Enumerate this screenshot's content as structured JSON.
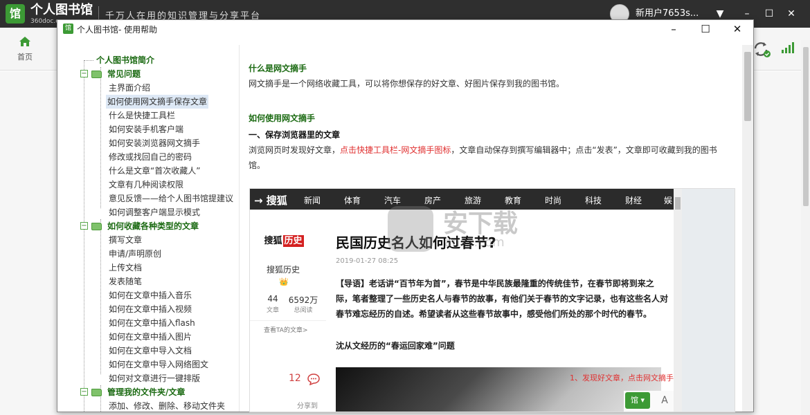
{
  "app": {
    "name": "个人图书馆",
    "domain": "360doc.c",
    "slogan": "千万人在用的知识管理与分享平台",
    "user_name": "新用户7653s...",
    "home_label": "首页",
    "logo_char": "馆"
  },
  "dialog": {
    "title": "个人图书馆- 使用帮助",
    "logo_char": "馆"
  },
  "nav": {
    "items": [
      {
        "label": "个人图书馆简介"
      },
      {
        "label": "常见问题"
      },
      {
        "label": "主界面介绍"
      },
      {
        "label": "如何使用网文摘手保存文章"
      },
      {
        "label": "什么是快捷工具栏"
      },
      {
        "label": "如何安装手机客户端"
      },
      {
        "label": "如何安装浏览器网文摘手"
      },
      {
        "label": "修改或找回自己的密码"
      },
      {
        "label": "什么是文章“首次收藏人”"
      },
      {
        "label": "文章有几种阅读权限"
      },
      {
        "label": "意见反馈——给个人图书馆提建议"
      },
      {
        "label": "如何调整客户端显示模式"
      },
      {
        "label": "如何收藏各种类型的文章"
      },
      {
        "label": "撰写文章"
      },
      {
        "label": "申请/声明原创"
      },
      {
        "label": "上传文档"
      },
      {
        "label": "发表随笔"
      },
      {
        "label": "如何在文章中插入音乐"
      },
      {
        "label": "如何在文章中插入视频"
      },
      {
        "label": "如何在文章中插入flash"
      },
      {
        "label": "如何在文章中插入图片"
      },
      {
        "label": "如何在文章中导入文档"
      },
      {
        "label": "如何在文章中导入网络图文"
      },
      {
        "label": "如何对文章进行一键排版"
      },
      {
        "label": "管理我的文件夹/文章"
      },
      {
        "label": "添加、修改、删除、移动文件夹"
      }
    ]
  },
  "article": {
    "h1": "什么是网文摘手",
    "p1": "网文摘手是一个网络收藏工具，可以将你想保存的好文章、好图片保存到我的图书馆。",
    "h2": "如何使用网文摘手",
    "sub1": "一、保存浏览器里的文章",
    "p2_a": "浏览网页时发现好文章，",
    "p2_red": "点击快捷工具栏-网文摘手图标",
    "p2_b": "，文章自动保存到撰写编辑器中；点击“发表”，文章即可收藏到我的图书",
    "p2_c": "馆。"
  },
  "screenshot": {
    "site_logo": "搜狐",
    "nav_items": [
      "新闻",
      "体育",
      "汽车",
      "房产",
      "旅游",
      "教育",
      "时尚",
      "科技",
      "财经",
      "娱"
    ],
    "author_logo_a": "搜狐",
    "author_logo_b": "历史",
    "author_name": "搜狐历史",
    "author_badge": "👑",
    "stat1_value": "44",
    "stat1_label": "文章",
    "stat2_value": "6592万",
    "stat2_label": "总阅读",
    "author_more": "查看TA的文章>",
    "share_count": "12",
    "share_label": "分享到",
    "title": "民国历史名人如何过春节?",
    "date": "2019-01-27 08:25",
    "lead": "【导语】老话讲“百节年为首”，春节是中华民族最隆重的传统佳节，在春节即将到来之际，笔者整理了一些历史名人与春节的故事，有他们关于春节的文字记录，也有这些名人对春节难忘经历的自述。希望读者从这些春节故事中，感受他们所处的那个时代的春节。",
    "subhead": "沈从文经历的“春运回家难”问题",
    "tip": "1、发现好文章，点击网文摘手图标",
    "clip_logo": "馆",
    "watermark": "安下载",
    "watermark_sub": "anxz.com"
  },
  "colors": {
    "brand_green": "#3c9a35",
    "heading_green": "#1b6a12",
    "highlight_red": "#e03030"
  }
}
